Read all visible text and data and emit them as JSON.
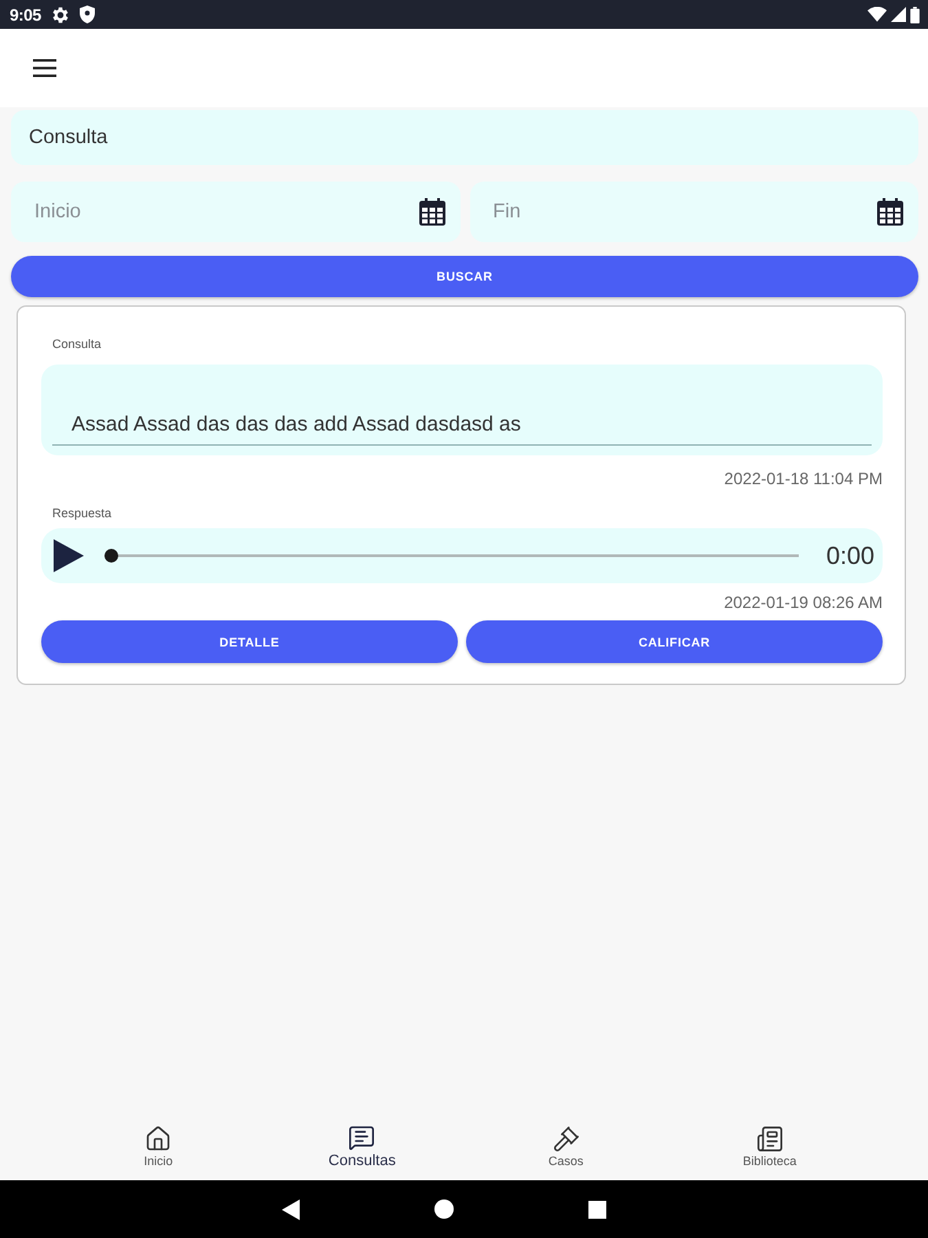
{
  "status_bar": {
    "time": "9:05"
  },
  "filters": {
    "query": {
      "placeholder": "Consulta"
    },
    "start_date": {
      "placeholder": "Inicio"
    },
    "end_date": {
      "placeholder": "Fin"
    },
    "search_button": "BUSCAR"
  },
  "results": [
    {
      "query_label": "Consulta",
      "query_text": "Assad Assad das das das add Assad dasdasd as",
      "query_time": "2022-01-18 11:04 PM",
      "answer_label": "Respuesta",
      "answer_audio": {
        "level": 0,
        "time": "0:00"
      },
      "answer_time": "2022-01-19 08:26 AM",
      "buttons": [
        "DETALLE",
        "CALIFICAR"
      ]
    }
  ],
  "bottom_nav": [
    {
      "label": "Inicio",
      "selected": false
    },
    {
      "label": "Consultas",
      "selected": true
    },
    {
      "label": "Casos",
      "selected": false
    },
    {
      "label": "Biblioteca",
      "selected": false
    }
  ]
}
